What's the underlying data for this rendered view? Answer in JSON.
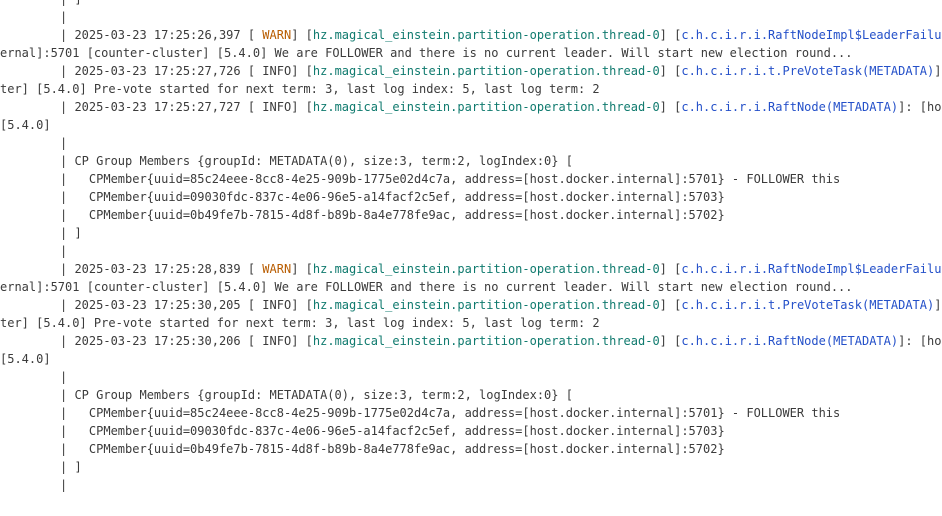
{
  "console": {
    "lines": [
      {
        "kind": "cont",
        "text": "| ]",
        "indent": 60
      },
      {
        "kind": "cont",
        "text": "|",
        "indent": 60
      },
      {
        "kind": "log",
        "prefix": "| 2025-03-23 17:25:26,397 [ ",
        "level": "WARN",
        "mid": "] [",
        "thread": "hz.magical_einstein.partition-operation.thread-0",
        "gap": "] [",
        "logger": "c.h.c.i.r.i.RaftNodeImpl$LeaderFailureDe",
        "indent": 60
      },
      {
        "kind": "cont",
        "text": "ernal]:5701 [counter-cluster] [5.4.0] We are FOLLOWER and there is no current leader. Will start new election round...",
        "indent": 0
      },
      {
        "kind": "log",
        "prefix": "| 2025-03-23 17:25:27,726 [ ",
        "level": "INFO",
        "mid": "] [",
        "thread": "hz.magical_einstein.partition-operation.thread-0",
        "gap": "] [",
        "logger": "c.h.c.i.r.i.t.PreVoteTask(METADATA)",
        "suffix": "]: [ho",
        "indent": 60
      },
      {
        "kind": "cont",
        "text": "ter] [5.4.0] Pre-vote started for next term: 3, last log index: 5, last log term: 2",
        "indent": 0
      },
      {
        "kind": "log",
        "prefix": "| 2025-03-23 17:25:27,727 [ ",
        "level": "INFO",
        "mid": "] [",
        "thread": "hz.magical_einstein.partition-operation.thread-0",
        "gap": "] [",
        "logger": "c.h.c.i.r.i.RaftNode(METADATA)",
        "suffix": "]: [host.do",
        "indent": 60
      },
      {
        "kind": "cont",
        "text": "[5.4.0]",
        "indent": 0
      },
      {
        "kind": "cont",
        "text": "|",
        "indent": 60
      },
      {
        "kind": "cont",
        "text": "| CP Group Members {groupId: METADATA(0), size:3, term:2, logIndex:0} [",
        "indent": 60
      },
      {
        "kind": "cont",
        "text": "|   CPMember{uuid=85c24eee-8cc8-4e25-909b-1775e02d4c7a, address=[host.docker.internal]:5701} - FOLLOWER this",
        "indent": 60
      },
      {
        "kind": "cont",
        "text": "|   CPMember{uuid=09030fdc-837c-4e06-96e5-a14facf2c5ef, address=[host.docker.internal]:5703}",
        "indent": 60
      },
      {
        "kind": "cont",
        "text": "|   CPMember{uuid=0b49fe7b-7815-4d8f-b89b-8a4e778fe9ac, address=[host.docker.internal]:5702}",
        "indent": 60
      },
      {
        "kind": "cont",
        "text": "| ]",
        "indent": 60
      },
      {
        "kind": "cont",
        "text": "|",
        "indent": 60
      },
      {
        "kind": "log",
        "prefix": "| 2025-03-23 17:25:28,839 [ ",
        "level": "WARN",
        "mid": "] [",
        "thread": "hz.magical_einstein.partition-operation.thread-0",
        "gap": "] [",
        "logger": "c.h.c.i.r.i.RaftNodeImpl$LeaderFailureDe",
        "indent": 60
      },
      {
        "kind": "cont",
        "text": "ernal]:5701 [counter-cluster] [5.4.0] We are FOLLOWER and there is no current leader. Will start new election round...",
        "indent": 0
      },
      {
        "kind": "log",
        "prefix": "| 2025-03-23 17:25:30,205 [ ",
        "level": "INFO",
        "mid": "] [",
        "thread": "hz.magical_einstein.partition-operation.thread-0",
        "gap": "] [",
        "logger": "c.h.c.i.r.i.t.PreVoteTask(METADATA)",
        "suffix": "]: [ho",
        "indent": 60
      },
      {
        "kind": "cont",
        "text": "ter] [5.4.0] Pre-vote started for next term: 3, last log index: 5, last log term: 2",
        "indent": 0
      },
      {
        "kind": "log",
        "prefix": "| 2025-03-23 17:25:30,206 [ ",
        "level": "INFO",
        "mid": "] [",
        "thread": "hz.magical_einstein.partition-operation.thread-0",
        "gap": "] [",
        "logger": "c.h.c.i.r.i.RaftNode(METADATA)",
        "suffix": "]: [host.do",
        "indent": 60
      },
      {
        "kind": "cont",
        "text": "[5.4.0]",
        "indent": 0
      },
      {
        "kind": "cont",
        "text": "|",
        "indent": 60
      },
      {
        "kind": "cont",
        "text": "| CP Group Members {groupId: METADATA(0), size:3, term:2, logIndex:0} [",
        "indent": 60
      },
      {
        "kind": "cont",
        "text": "|   CPMember{uuid=85c24eee-8cc8-4e25-909b-1775e02d4c7a, address=[host.docker.internal]:5701} - FOLLOWER this",
        "indent": 60
      },
      {
        "kind": "cont",
        "text": "|   CPMember{uuid=09030fdc-837c-4e06-96e5-a14facf2c5ef, address=[host.docker.internal]:5703}",
        "indent": 60
      },
      {
        "kind": "cont",
        "text": "|   CPMember{uuid=0b49fe7b-7815-4d8f-b89b-8a4e778fe9ac, address=[host.docker.internal]:5702}",
        "indent": 60
      },
      {
        "kind": "cont",
        "text": "| ]",
        "indent": 60
      },
      {
        "kind": "cont",
        "text": "|",
        "indent": 60
      }
    ]
  },
  "colors": {
    "text": "#3b3b3b",
    "warn": "#b85c00",
    "thread": "#0f7a6e",
    "logger": "#2450c9",
    "background": "#ffffff"
  }
}
